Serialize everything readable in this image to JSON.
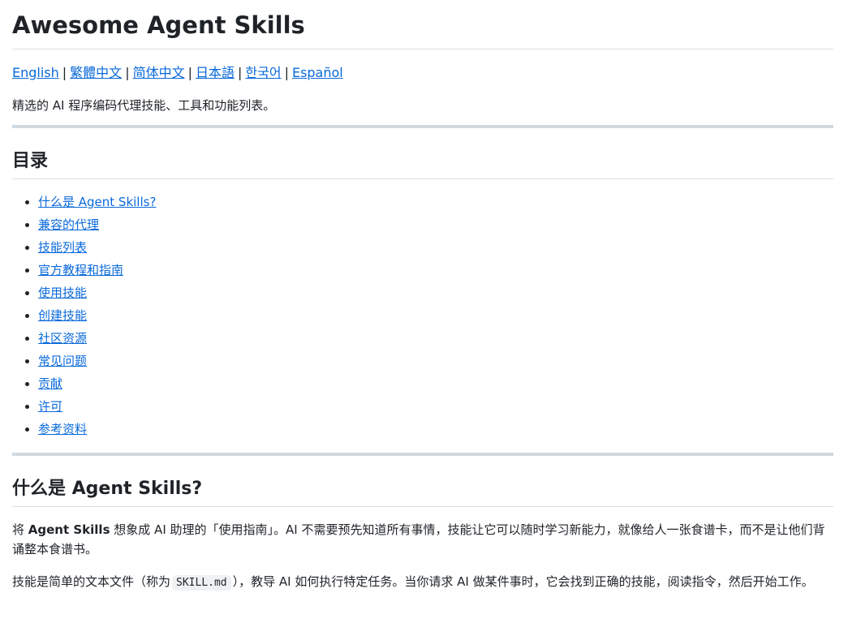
{
  "title": "Awesome Agent Skills",
  "languages": [
    {
      "label": "English"
    },
    {
      "label": "繁體中文"
    },
    {
      "label": "简体中文"
    },
    {
      "label": "日本語"
    },
    {
      "label": "한국어"
    },
    {
      "label": "Español"
    }
  ],
  "language_separator": "|",
  "description": "精选的 AI 程序编码代理技能、工具和功能列表。",
  "toc": {
    "heading": "目录",
    "items": [
      {
        "label": "什么是 Agent Skills?"
      },
      {
        "label": "兼容的代理"
      },
      {
        "label": "技能列表"
      },
      {
        "label": "官方教程和指南"
      },
      {
        "label": "使用技能"
      },
      {
        "label": "创建技能"
      },
      {
        "label": "社区资源"
      },
      {
        "label": "常见问题"
      },
      {
        "label": "贡献"
      },
      {
        "label": "许可"
      },
      {
        "label": "参考资料"
      }
    ]
  },
  "what_section": {
    "heading": "什么是 Agent Skills?",
    "p1_prefix": "将 ",
    "p1_bold": "Agent Skills",
    "p1_suffix": " 想象成 AI 助理的「使用指南」。AI 不需要预先知道所有事情，技能让它可以随时学习新能力，就像给人一张食谱卡，而不是让他们背诵整本食谱书。",
    "p2_prefix": "技能是简单的文本文件（称为",
    "p2_code": "SKILL.md",
    "p2_suffix": "），教导 AI 如何执行特定任务。当你请求 AI 做某件事时，它会找到正确的技能，阅读指令，然后开始工作。"
  }
}
